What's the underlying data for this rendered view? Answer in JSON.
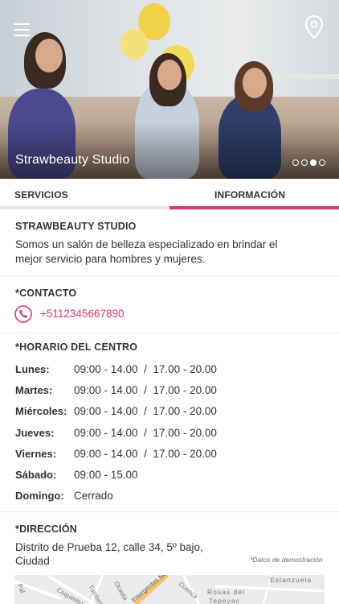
{
  "header": {
    "studio_name": "Strawbeauty Studio",
    "carousel_total": 4,
    "carousel_active_index": 2
  },
  "tabs": [
    {
      "label": "SERVICIOS",
      "active": false
    },
    {
      "label": "INFORMACIÓN",
      "active": true
    }
  ],
  "about": {
    "title": "STRAWBEAUTY STUDIO",
    "description_line1": "Somos un salón de belleza especializado en brindar el",
    "description_line2": "mejor servicio para hombres y mujeres."
  },
  "contact": {
    "title": "*CONTACTO",
    "phone": "+5112345667890"
  },
  "hours": {
    "title": "*HORARIO DEL CENTRO",
    "rows": [
      {
        "day": "Lunes:",
        "time": "09:00 - 14.00  /  17.00 - 20.00"
      },
      {
        "day": "Martes:",
        "time": "09:00 - 14.00  /  17.00 - 20.00"
      },
      {
        "day": "Miércoles:",
        "time": "09:00 - 14.00  /  17.00 - 20.00"
      },
      {
        "day": "Jueves:",
        "time": "09:00 - 14.00  /  17.00 - 20.00"
      },
      {
        "day": "Viernes:",
        "time": "09:00 - 14.00  /  17.00 - 20.00"
      },
      {
        "day": "Sábado:",
        "time": "09:00 - 15.00"
      },
      {
        "day": "Domingo:",
        "time": "Cerrado"
      }
    ]
  },
  "address": {
    "title": "*DIRECCIÓN",
    "line1": "Distrito de Prueba 12, calle 34, 5º bajo,",
    "line2": "Ciudad",
    "demo_note": "*Datos de demostración"
  },
  "map": {
    "labels": [
      "Pal",
      "Coquimbo",
      "Tumbes",
      "Ocasta",
      "Rosas del",
      "Tepeyac",
      "Estanzuela",
      "Cuenca",
      "Insurgentes Norte"
    ]
  },
  "colors": {
    "accent": "#e0336f",
    "text": "#333333",
    "divider": "#ececec"
  },
  "icons": {
    "menu": "hamburger-icon",
    "location": "map-pin-icon",
    "phone": "phone-icon"
  }
}
